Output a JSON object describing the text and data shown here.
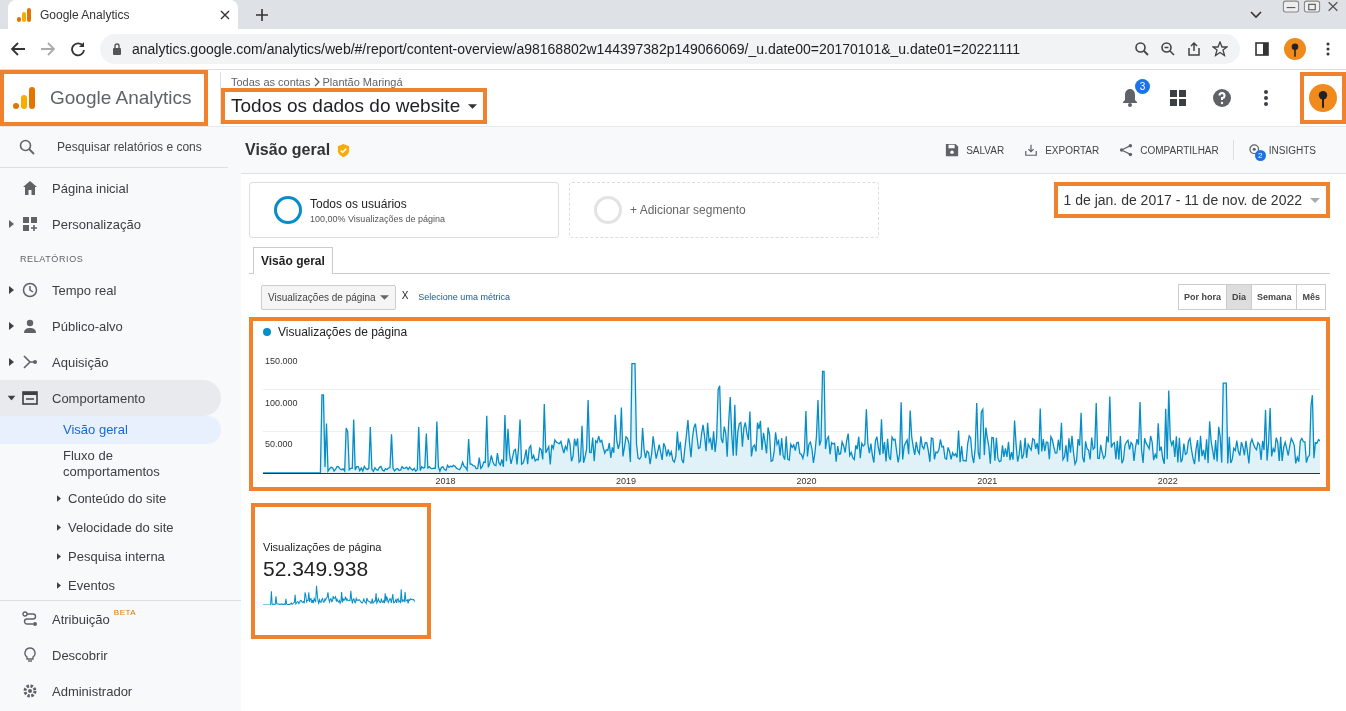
{
  "browser": {
    "tab_title": "Google Analytics",
    "url": "analytics.google.com/analytics/web/#/report/content-overview/a98168802w144397382p149066069/_u.date00=20170101&_u.date01=20221111"
  },
  "header": {
    "product": "Google Analytics",
    "product_highlighted": true,
    "breadcrumb": [
      "Todas as contas",
      "Plantão Maringá"
    ],
    "property": "Todos os dados do website",
    "property_highlighted": true,
    "notifications": "3",
    "avatar_highlighted": true
  },
  "sidebar": {
    "search_placeholder": "Pesquisar relatórios e cons",
    "top_items": [
      {
        "label": "Página inicial",
        "expandable": false
      },
      {
        "label": "Personalização",
        "expandable": true
      }
    ],
    "section_label": "RELATÓRIOS",
    "reports": [
      {
        "label": "Tempo real",
        "expanded": false,
        "selected": false
      },
      {
        "label": "Público-alvo",
        "expanded": false,
        "selected": false
      },
      {
        "label": "Aquisição",
        "expanded": false,
        "selected": false
      },
      {
        "label": "Comportamento",
        "expanded": true,
        "selected": true,
        "children": [
          {
            "label": "Visão geral",
            "selected": true,
            "expandable": false
          },
          {
            "label": "Fluxo de comportamentos",
            "selected": false,
            "expandable": false
          },
          {
            "label": "Conteúdo do site",
            "selected": false,
            "expandable": true
          },
          {
            "label": "Velocidade do site",
            "selected": false,
            "expandable": true
          },
          {
            "label": "Pesquisa interna",
            "selected": false,
            "expandable": true
          },
          {
            "label": "Eventos",
            "selected": false,
            "expandable": true
          }
        ]
      }
    ],
    "bottom_items": [
      {
        "label": "Atribuição",
        "badge": "BETA"
      },
      {
        "label": "Descobrir"
      },
      {
        "label": "Administrador"
      }
    ]
  },
  "main": {
    "title": "Visão geral",
    "actions": [
      {
        "label": "SALVAR"
      },
      {
        "label": "EXPORTAR"
      },
      {
        "label": "COMPARTILHAR"
      },
      {
        "label": "INSIGHTS",
        "badge": "2"
      }
    ],
    "segment": {
      "name": "Todos os usuários",
      "detail": "100,00% Visualizações de página"
    },
    "add_segment": "+ Adicionar segmento",
    "date_range": "1 de jan. de 2017 - 11 de nov. de 2022",
    "date_range_highlighted": true,
    "tabs": [
      {
        "label": "Visão geral",
        "selected": true
      }
    ],
    "metric": "Visualizações de página",
    "remove_metric": "X",
    "select_metric": "Selecione uma métrica",
    "granularity": [
      {
        "label": "Por hora",
        "selected": false
      },
      {
        "label": "Dia",
        "selected": true
      },
      {
        "label": "Semana",
        "selected": false
      },
      {
        "label": "Mês",
        "selected": false
      }
    ],
    "chart": {
      "legend": "Visualizações de página",
      "color": "#058dc7",
      "highlighted": true,
      "y_labels": [
        "150.000",
        "100.000",
        "50.000"
      ],
      "x_labels": [
        "2018",
        "2019",
        "2020",
        "2021",
        "2022"
      ]
    },
    "scorecard": {
      "label": "Visualizações de página",
      "value": "52.349.938",
      "highlighted": true
    }
  }
}
